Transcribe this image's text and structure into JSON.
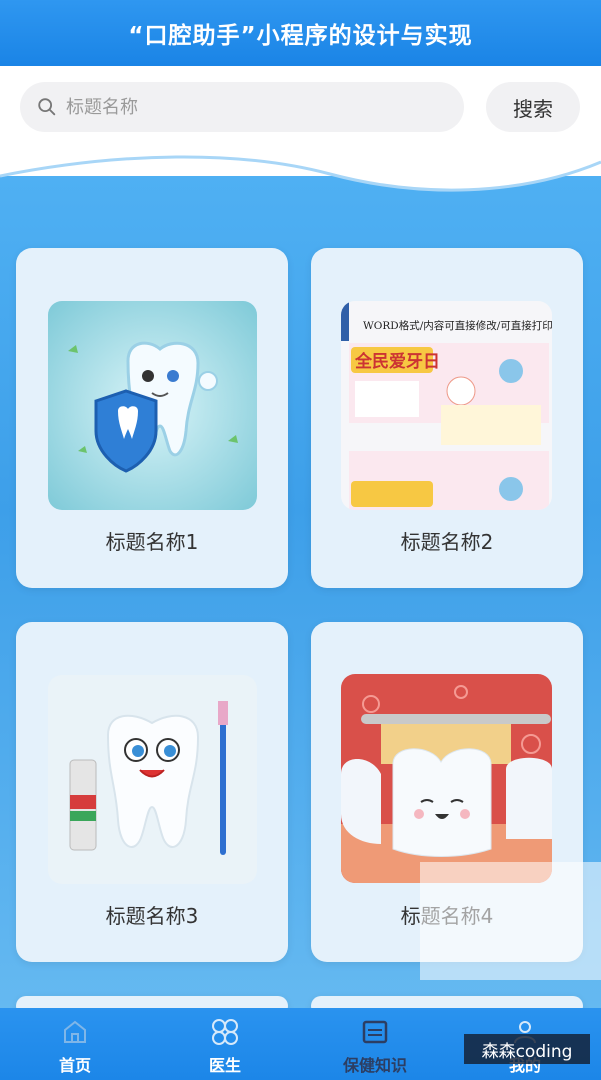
{
  "header": {
    "title": "“口腔助手”小程序的设计与实现"
  },
  "search": {
    "placeholder": "标题名称",
    "button_label": "搜索"
  },
  "cards": [
    {
      "title": "标题名称1",
      "image": "tooth-shield-illustration"
    },
    {
      "title": "标题名称2",
      "image": "love-teeth-poster",
      "poster_banner": "WORD格式/内容可直接修改/可直接打印",
      "poster_heading": "全民爱牙日"
    },
    {
      "title": "标题名称3",
      "image": "tooth-with-toothbrush-toothpaste"
    },
    {
      "title": "标题名称4",
      "image": "smiling-teeth-toothbrush"
    }
  ],
  "tabbar": {
    "items": [
      {
        "label": "首页",
        "icon": "home-icon",
        "active": false
      },
      {
        "label": "医生",
        "icon": "grid-icon",
        "active": false
      },
      {
        "label": "保健知识",
        "icon": "document-icon",
        "active": true
      },
      {
        "label": "我的",
        "icon": "user-icon",
        "active": false
      }
    ]
  },
  "watermark": {
    "text": "森森coding"
  },
  "colors": {
    "primary": "#1a84e6",
    "card_bg": "#e4f1fb",
    "active_tab": "#2c3e63"
  }
}
